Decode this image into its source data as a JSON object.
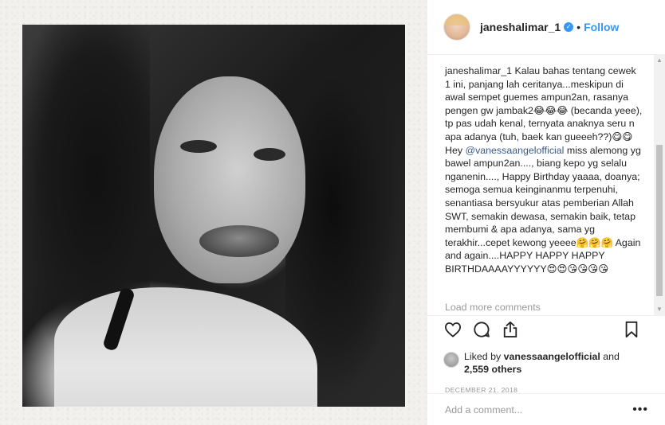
{
  "post": {
    "username": "janeshalimar_1",
    "follow_label": "Follow",
    "separator": "•",
    "verified_glyph": "✓"
  },
  "caption": {
    "author": "janeshalimar_1",
    "text_part1": " Kalau bahas tentang cewek 1 ini, panjang lah ceritanya...meskipun di awal sempet guemes ampun2an, rasanya pengen gw jambak2😂😂😂 (becanda yeee), tp pas udah kenal, ternyata anaknya seru n apa adanya (tuh, baek kan gueeeh??)😋😋 Hey ",
    "mention": "@vanessaangelofficial",
    "text_part2": " miss alemong yg bawel ampun2an...., biang kepo yg selalu nganenin...., Happy Birthday yaaaa, doanya; semoga semua keinginanmu terpenuhi, senantiasa bersyukur atas pemberian Allah SWT, semakin dewasa, semakin baik, tetap membumi & apa adanya, sama yg terakhir...cepet kewong yeeee🤗🤗🤗 Again and again....HAPPY HAPPY HAPPY BIRTHDAAAAYYYYYY😍😍😘😘😘😘"
  },
  "load_more_label": "Load more comments",
  "likes": {
    "prefix": "Liked by ",
    "user": "vanessaangelofficial",
    "middle": " and",
    "count": "2,559 others"
  },
  "date": "DECEMBER 21, 2018",
  "comment_input": {
    "placeholder": "Add a comment..."
  },
  "more_glyph": "•••",
  "icons": {
    "like": "heart-icon",
    "comment": "comment-icon",
    "share": "share-icon",
    "save": "bookmark-icon",
    "options": "more-options-icon"
  },
  "colors": {
    "link": "#3897f0",
    "muted": "#999999",
    "text": "#262626"
  }
}
